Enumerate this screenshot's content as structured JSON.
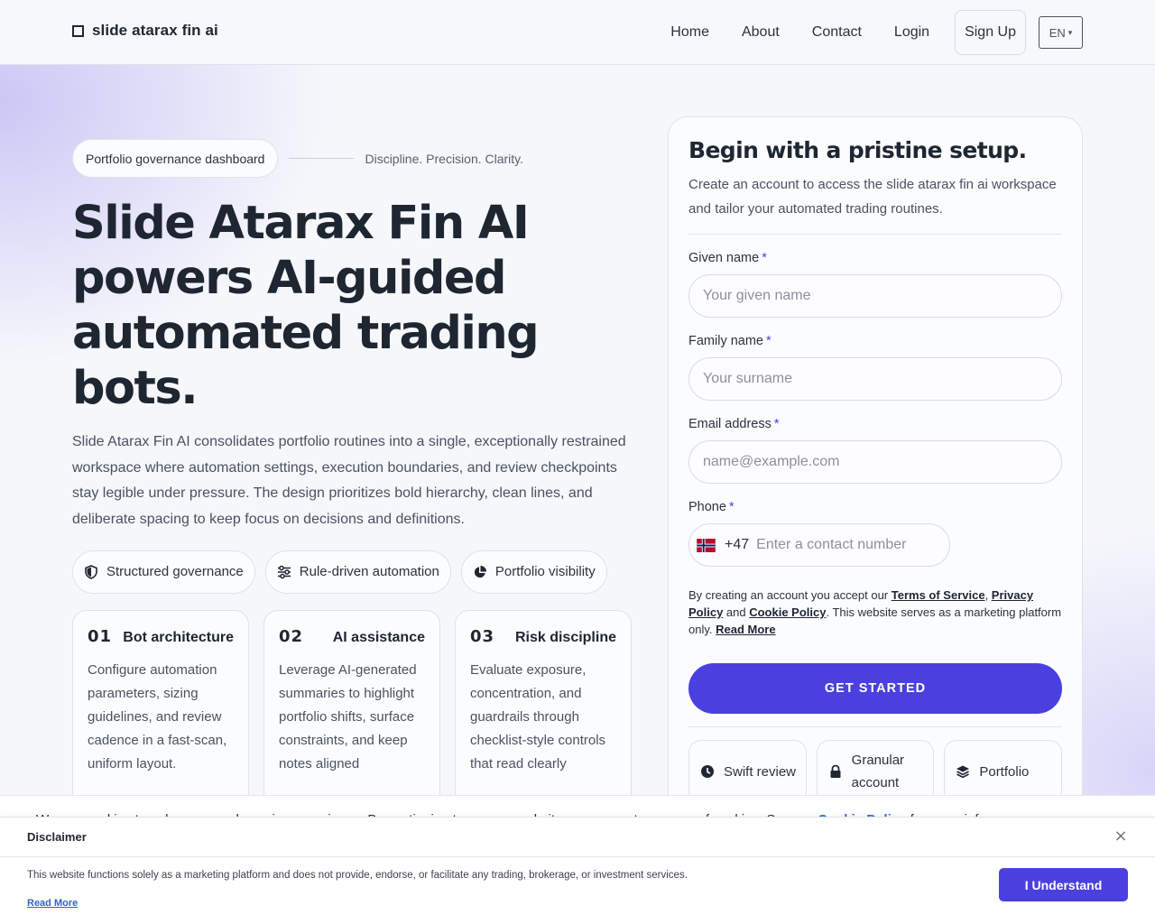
{
  "header": {
    "brand": "slide atarax fin ai",
    "nav": [
      "Home",
      "About",
      "Contact",
      "Login"
    ],
    "signup": "Sign Up",
    "language": "EN",
    "language_caret": "▾"
  },
  "hero": {
    "pill": "Portfolio governance dashboard",
    "tagline": "Discipline. Precision. Clarity.",
    "title": "Slide Atarax Fin AI powers AI-guided automated trading bots.",
    "description": "Slide Atarax Fin AI consolidates portfolio routines into a single, exceptionally re­strained workspace where automation settings, execution boundaries, and re­view checkpoints stay legible under pressure. The design prioritizes bold hierar­chy, clean lines, and deliberate spacing to keep focus on decisions and defini­tions.",
    "chips": [
      {
        "label": "Structured governance",
        "icon": "shield-icon"
      },
      {
        "label": "Rule-driven automation",
        "icon": "sliders-icon"
      },
      {
        "label": "Portfolio visibility",
        "icon": "pie-chart-icon"
      }
    ],
    "cards": [
      {
        "num": "01",
        "title": "Bot architecture",
        "text": "Configure automation parameters, sizing guidelines, and review cadence in a fast-scan, uniform layout."
      },
      {
        "num": "02",
        "title": "AI assistance",
        "text": "Leverage AI-generated summaries to highlight portfolio shifts, sur­face constraints, and keep notes aligned"
      },
      {
        "num": "03",
        "title": "Risk discipline",
        "text": "Evaluate exposure, concentration, and guardrails through checklist-style con­trols that read clearly"
      }
    ]
  },
  "form": {
    "title": "Begin with a pristine setup.",
    "subtitle": "Create an account to access the slide atarax fin ai workspace and tailor your automated trading routines.",
    "required_mark": "*",
    "given_name_label": "Given name",
    "given_name_placeholder": "Your given name",
    "family_name_label": "Family name",
    "family_name_placeholder": "Your surname",
    "email_label": "Email address",
    "email_placeholder": "name@example.com",
    "phone_label": "Phone",
    "phone_dial": "+47",
    "phone_placeholder": "Enter a contact number",
    "legal_prefix": "By creating an account you accept our ",
    "terms": "Terms of Service",
    "comma": ", ",
    "privacy": "Privacy Policy",
    "and": " and ",
    "cookie": "Cookie Policy",
    "legal_suffix": ". This website serves as a marketing plat­form only. ",
    "read_more": "Read More",
    "cta": "GET STARTED",
    "features": [
      {
        "label": "Swift review",
        "icon": "clock-icon"
      },
      {
        "label": "Granular account",
        "icon": "lock-icon"
      },
      {
        "label": "Portfolio",
        "icon": "layers-icon"
      }
    ]
  },
  "cookie_strip": {
    "text": "We use cookies to enhance your browsing experience. By continuing to use our website, you agree to our use of cookies. See our ",
    "link": "Cookie Policy",
    "tail": " for more info."
  },
  "disclaimer": {
    "title": "Disclaimer",
    "close": "×",
    "text": "This website functions solely as a marketing platform and does not provide, endorse, or facilitate any trading, brokerage, or investment services.",
    "read_more": "Read More",
    "button": "I Understand"
  },
  "colors": {
    "accent": "#4a40e0",
    "link": "#2f66c8",
    "text": "#1e2632"
  }
}
